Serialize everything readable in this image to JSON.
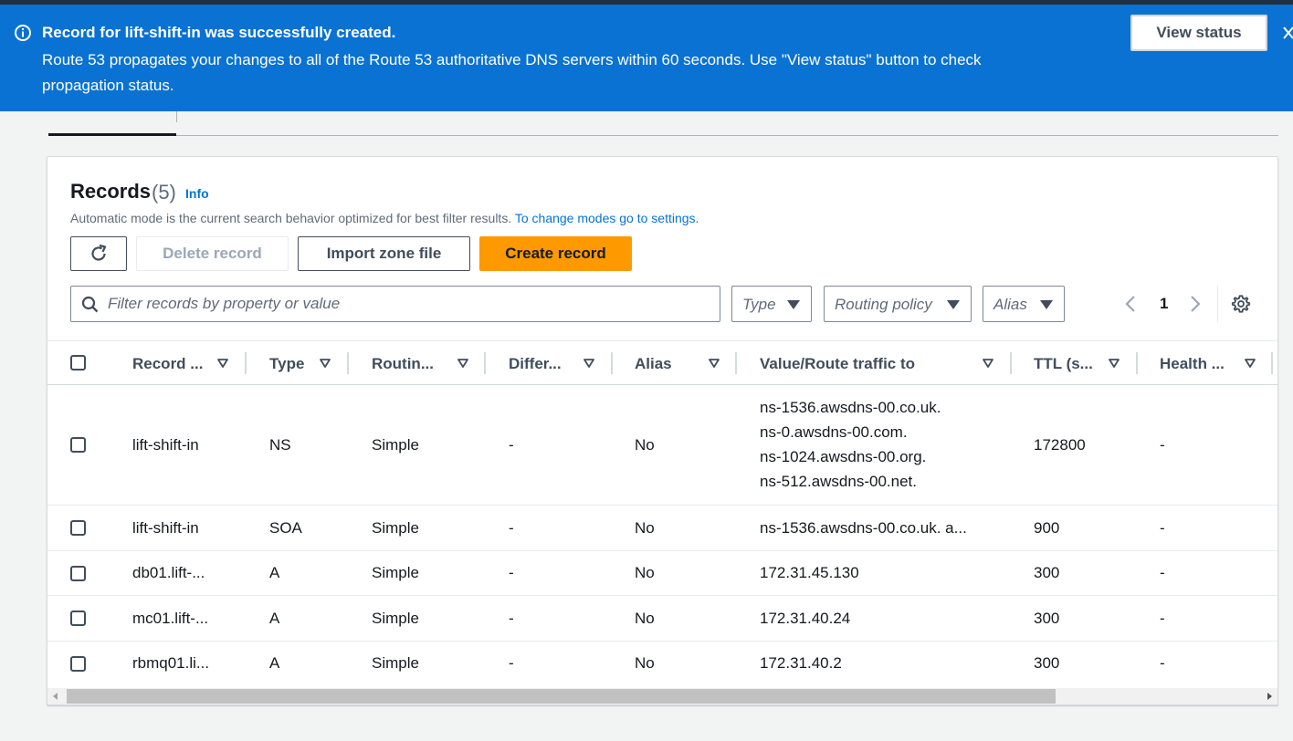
{
  "flash": {
    "title": "Record for lift-shift-in was successfully created.",
    "message": "Route 53 propagates your changes to all of the Route 53 authoritative DNS servers within 60 seconds. Use \"View status\" button to check propagation status.",
    "view_status_label": "View status",
    "info_icon": "info-circle-icon",
    "close_icon": "close-icon",
    "color": "#0972d3"
  },
  "records": {
    "title": "Records",
    "count": "(5)",
    "info_label": "Info",
    "description": "Automatic mode is the current search behavior optimized for best filter results.",
    "description_link": "To change modes go to settings.",
    "refresh_icon": "refresh-icon",
    "delete_label": "Delete record",
    "import_label": "Import zone file",
    "create_label": "Create record",
    "create_color": "#ff9900",
    "search_placeholder": "Filter records by property or value",
    "filter_type": "Type",
    "filter_routing": "Routing policy",
    "filter_alias": "Alias",
    "page": "1",
    "settings_icon": "gear-icon"
  },
  "columns": [
    "Record ...",
    "Type",
    "Routin...",
    "Differ...",
    "Alias",
    "Value/Route traffic to",
    "TTL (s...",
    "Health ..."
  ],
  "rows": [
    {
      "name": "lift-shift-in",
      "type": "NS",
      "routing": "Simple",
      "differ": "-",
      "alias": "No",
      "values": [
        "ns-1536.awsdns-00.co.uk.",
        "ns-0.awsdns-00.com.",
        "ns-1024.awsdns-00.org.",
        "ns-512.awsdns-00.net."
      ],
      "ttl": "172800",
      "health": "-"
    },
    {
      "name": "lift-shift-in",
      "type": "SOA",
      "routing": "Simple",
      "differ": "-",
      "alias": "No",
      "values": [
        "ns-1536.awsdns-00.co.uk. a..."
      ],
      "ttl": "900",
      "health": "-"
    },
    {
      "name": "db01.lift-...",
      "type": "A",
      "routing": "Simple",
      "differ": "-",
      "alias": "No",
      "values": [
        "172.31.45.130"
      ],
      "ttl": "300",
      "health": "-"
    },
    {
      "name": "mc01.lift-...",
      "type": "A",
      "routing": "Simple",
      "differ": "-",
      "alias": "No",
      "values": [
        "172.31.40.24"
      ],
      "ttl": "300",
      "health": "-"
    },
    {
      "name": "rbmq01.li...",
      "type": "A",
      "routing": "Simple",
      "differ": "-",
      "alias": "No",
      "values": [
        "172.31.40.2"
      ],
      "ttl": "300",
      "health": "-"
    }
  ]
}
